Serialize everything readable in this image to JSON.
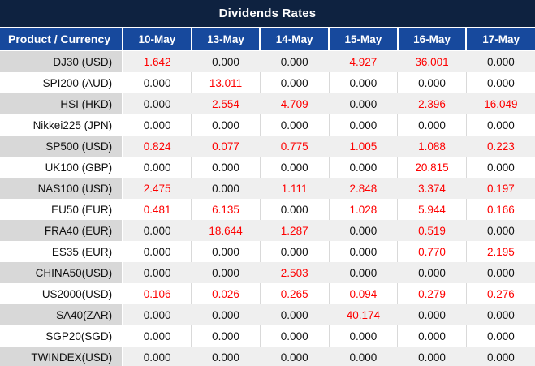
{
  "title": "Dividends Rates",
  "table": {
    "product_header": "Product / Currency",
    "date_headers": [
      "10-May",
      "13-May",
      "14-May",
      "15-May",
      "16-May",
      "17-May"
    ],
    "rows": [
      {
        "product": "DJ30 (USD)",
        "values": [
          "1.642",
          "0.000",
          "0.000",
          "4.927",
          "36.001",
          "0.000"
        ]
      },
      {
        "product": "SPI200 (AUD)",
        "values": [
          "0.000",
          "13.011",
          "0.000",
          "0.000",
          "0.000",
          "0.000"
        ]
      },
      {
        "product": "HSI (HKD)",
        "values": [
          "0.000",
          "2.554",
          "4.709",
          "0.000",
          "2.396",
          "16.049"
        ]
      },
      {
        "product": "Nikkei225 (JPN)",
        "values": [
          "0.000",
          "0.000",
          "0.000",
          "0.000",
          "0.000",
          "0.000"
        ]
      },
      {
        "product": "SP500 (USD)",
        "values": [
          "0.824",
          "0.077",
          "0.775",
          "1.005",
          "1.088",
          "0.223"
        ]
      },
      {
        "product": "UK100 (GBP)",
        "values": [
          "0.000",
          "0.000",
          "0.000",
          "0.000",
          "20.815",
          "0.000"
        ]
      },
      {
        "product": "NAS100 (USD)",
        "values": [
          "2.475",
          "0.000",
          "1.111",
          "2.848",
          "3.374",
          "0.197"
        ]
      },
      {
        "product": "EU50 (EUR)",
        "values": [
          "0.481",
          "6.135",
          "0.000",
          "1.028",
          "5.944",
          "0.166"
        ]
      },
      {
        "product": "FRA40 (EUR)",
        "values": [
          "0.000",
          "18.644",
          "1.287",
          "0.000",
          "0.519",
          "0.000"
        ]
      },
      {
        "product": "ES35 (EUR)",
        "values": [
          "0.000",
          "0.000",
          "0.000",
          "0.000",
          "0.770",
          "2.195"
        ]
      },
      {
        "product": "CHINA50(USD)",
        "values": [
          "0.000",
          "0.000",
          "2.503",
          "0.000",
          "0.000",
          "0.000"
        ]
      },
      {
        "product": "US2000(USD)",
        "values": [
          "0.106",
          "0.026",
          "0.265",
          "0.094",
          "0.279",
          "0.276"
        ]
      },
      {
        "product": "SA40(ZAR)",
        "values": [
          "0.000",
          "0.000",
          "0.000",
          "40.174",
          "0.000",
          "0.000"
        ]
      },
      {
        "product": "SGP20(SGD)",
        "values": [
          "0.000",
          "0.000",
          "0.000",
          "0.000",
          "0.000",
          "0.000"
        ]
      },
      {
        "product": "TWINDEX(USD)",
        "values": [
          "0.000",
          "0.000",
          "0.000",
          "0.000",
          "0.000",
          "0.000"
        ]
      }
    ]
  },
  "colors": {
    "title_bg": "#0e2240",
    "header_bg": "#17499d",
    "row_gray": "#efefef",
    "product_gray": "#d8d8d8",
    "divider": "#d9d9d9",
    "nonzero_red": "#fe0000",
    "zero_black": "#111111"
  }
}
